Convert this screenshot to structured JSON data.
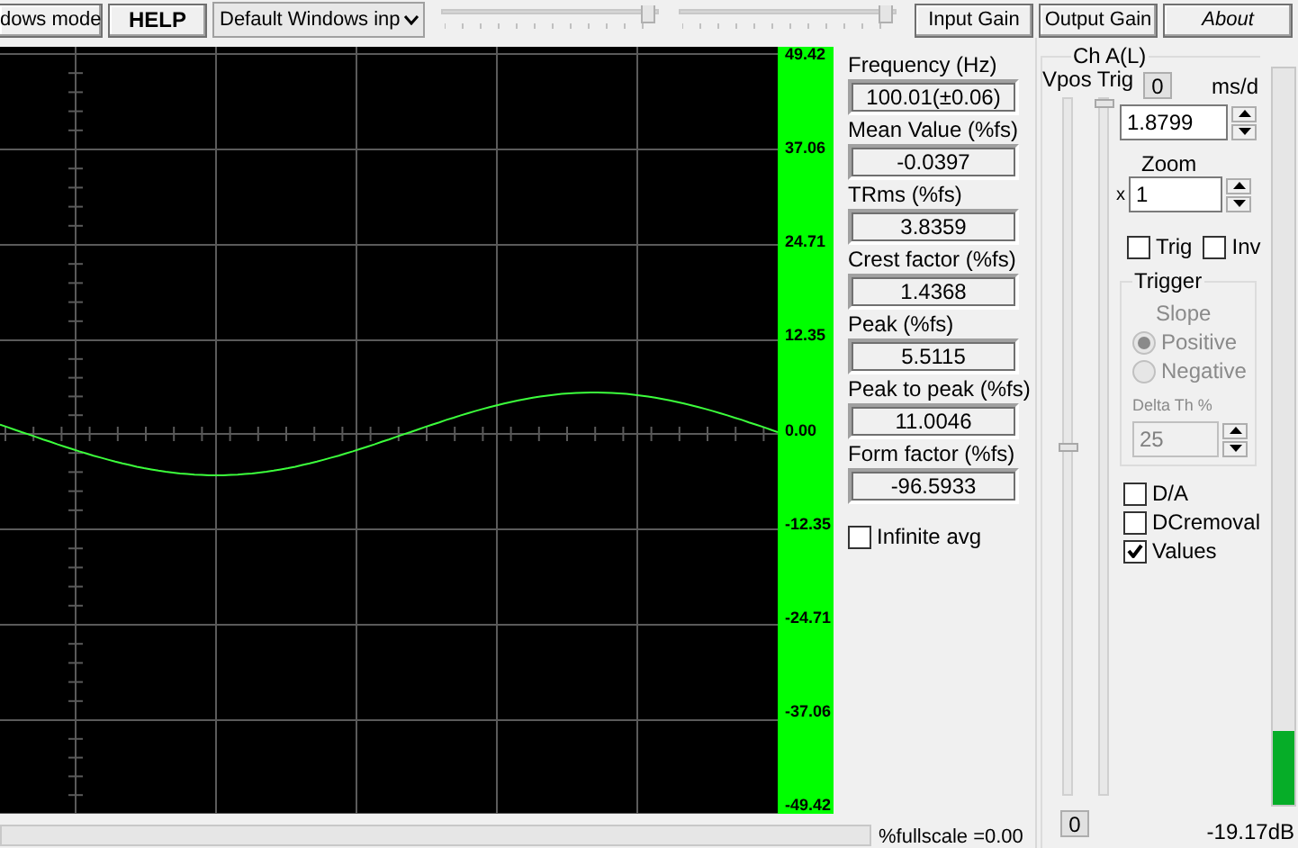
{
  "toolbar": {
    "mode_button": "dows mode",
    "help_button": "HELP",
    "device_select": "Default Windows inp",
    "sliders": [
      {
        "level": 1
      },
      {
        "level": 1
      }
    ],
    "buttons": [
      {
        "label": "Input Gain",
        "kind": "plain"
      },
      {
        "label": "Output Gain",
        "kind": "plain"
      },
      {
        "label": "About",
        "kind": "italic"
      }
    ]
  },
  "scope": {
    "scale_labels": [
      "49.42",
      "37.06",
      "24.71",
      "12.35",
      "0.00",
      "-12.35",
      "-24.71",
      "-37.06",
      "-49.42"
    ]
  },
  "measurements": [
    {
      "label": "Frequency (Hz)",
      "value": "100.01(±0.06)"
    },
    {
      "label": "Mean Value (%fs)",
      "value": "-0.0397"
    },
    {
      "label": "TRms (%fs)",
      "value": "3.8359"
    },
    {
      "label": "Crest factor (%fs)",
      "value": "1.4368"
    },
    {
      "label": "Peak (%fs)",
      "value": "5.5115"
    },
    {
      "label": "Peak to peak (%fs)",
      "value": "11.0046"
    },
    {
      "label": "Form factor (%fs)",
      "value": "-96.5933"
    }
  ],
  "infinite_avg": {
    "label": "Infinite avg",
    "checked": false
  },
  "status": {
    "fullscale": "%fullscale =0.00"
  },
  "channel": {
    "title": "Ch A(L)",
    "sliders": [
      {
        "label": "Vpos",
        "level": 0.5
      },
      {
        "label": "Trig",
        "level": 1
      }
    ],
    "reset_button": "0"
  },
  "timebase": {
    "reset_button": "0",
    "unit": "ms/d",
    "value": "1.8799"
  },
  "zoom": {
    "label": "Zoom",
    "prefix": "x",
    "value": "1"
  },
  "trig_checks": [
    {
      "label": "Trig",
      "checked": false
    },
    {
      "label": "Inv",
      "checked": false
    }
  ],
  "trigger": {
    "title": "Trigger",
    "disabled": true,
    "slope_label": "Slope",
    "options": [
      {
        "label": "Positive",
        "selected": true
      },
      {
        "label": "Negative",
        "selected": false
      }
    ],
    "delta_label": "Delta Th %",
    "delta_value": "25"
  },
  "options": [
    {
      "label": "D/A",
      "checked": false
    },
    {
      "label": "DCremoval",
      "checked": false
    },
    {
      "label": "Values",
      "checked": true
    }
  ],
  "meter": {
    "level": 0.1,
    "reading": "-19.17dB"
  }
}
